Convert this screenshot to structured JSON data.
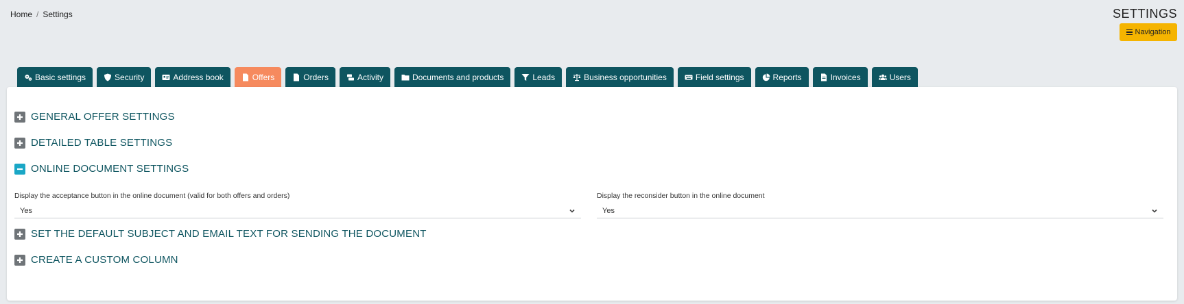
{
  "breadcrumb": {
    "home": "Home",
    "separator": "/",
    "current": "Settings"
  },
  "header": {
    "title": "SETTINGS",
    "navigation_label": "Navigation"
  },
  "colors": {
    "tab_bg": "#0e5560",
    "tab_active": "#f68a5e",
    "nav_button": "#f5b400",
    "open_toggle": "#1aa7c6"
  },
  "tabs": [
    {
      "label": "Basic settings",
      "icon": "gears-icon"
    },
    {
      "label": "Security",
      "icon": "shield-icon"
    },
    {
      "label": "Address book",
      "icon": "id-card-icon"
    },
    {
      "label": "Offers",
      "icon": "document-icon",
      "active": true
    },
    {
      "label": "Orders",
      "icon": "document-icon"
    },
    {
      "label": "Activity",
      "icon": "activity-icon"
    },
    {
      "label": "Documents and products",
      "icon": "folder-icon"
    },
    {
      "label": "Leads",
      "icon": "funnel-icon"
    },
    {
      "label": "Business opportunities",
      "icon": "scale-icon"
    },
    {
      "label": "Field settings",
      "icon": "keyboard-icon"
    },
    {
      "label": "Reports",
      "icon": "pie-chart-icon"
    },
    {
      "label": "Invoices",
      "icon": "invoice-icon"
    },
    {
      "label": "Users",
      "icon": "users-icon"
    }
  ],
  "sections": [
    {
      "title": "GENERAL OFFER SETTINGS",
      "expanded": false
    },
    {
      "title": "DETAILED TABLE SETTINGS",
      "expanded": false
    },
    {
      "title": "ONLINE DOCUMENT SETTINGS",
      "expanded": true
    },
    {
      "title": "SET THE DEFAULT SUBJECT AND EMAIL TEXT FOR SENDING THE DOCUMENT",
      "expanded": false
    },
    {
      "title": "CREATE A CUSTOM COLUMN",
      "expanded": false
    }
  ],
  "online_document": {
    "acceptance": {
      "label": "Display the acceptance button in the online document (valid for both offers and orders)",
      "value": "Yes"
    },
    "reconsider": {
      "label": "Display the reconsider button in the online document",
      "value": "Yes"
    }
  }
}
